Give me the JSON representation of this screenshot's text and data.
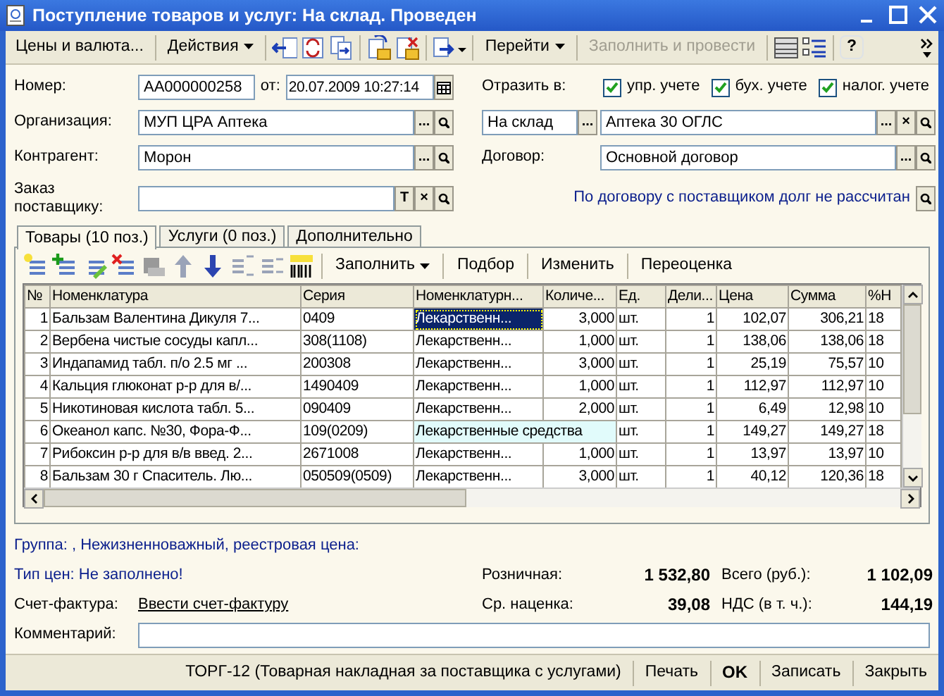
{
  "window": {
    "title": "Поступление товаров и услуг: На склад. Проведен"
  },
  "toolbar": {
    "buttons": [
      {
        "label": "Цены и валюта...",
        "kind": "button",
        "disabled": false
      },
      {
        "label": "Действия",
        "kind": "menu",
        "disabled": false
      },
      {
        "label": "Перейти",
        "kind": "menu",
        "disabled": false
      },
      {
        "label": "Заполнить и провести",
        "kind": "button",
        "disabled": true
      }
    ],
    "help": "?"
  },
  "number": {
    "label": "Номер:",
    "value": "АА000000258"
  },
  "date": {
    "label": "от:",
    "value": "20.07.2009 10:27:14"
  },
  "reflect": {
    "label": "Отразить в:",
    "options": [
      {
        "label": "упр. учете",
        "checked": true
      },
      {
        "label": "бух. учете",
        "checked": true
      },
      {
        "label": "налог. учете",
        "checked": true
      }
    ]
  },
  "organization": {
    "label": "Организация:",
    "value": "МУП ЦРА Аптека",
    "buttons": [
      "..."
    ],
    "search": true
  },
  "warehouse": {
    "kind_value": "На склад",
    "kind_buttons": [
      "..."
    ],
    "value": "Аптека 30 ОГЛС",
    "buttons": [
      "...",
      "×"
    ],
    "search": true
  },
  "counterparty": {
    "label": "Контрагент:",
    "value": "Морон",
    "buttons": [
      "..."
    ],
    "search": true
  },
  "contract": {
    "label": "Договор:",
    "value": "Основной договор",
    "buttons": [
      "..."
    ],
    "search": true
  },
  "order": {
    "label": "Заказ поставщику:",
    "buttons": [
      "T",
      "×"
    ],
    "search": true
  },
  "debt_link": {
    "text": "По договору с поставщиком долг не рассчитан",
    "search": true
  },
  "tabs": [
    {
      "label": "Товары (10 поз.)",
      "selected": true
    },
    {
      "label": "Услуги (0 поз.)",
      "selected": false
    },
    {
      "label": "Дополнительно",
      "selected": false
    }
  ],
  "tab_toolbar": {
    "buttons": [
      {
        "label": "Заполнить",
        "kind": "menu"
      },
      {
        "label": "Подбор",
        "kind": "button"
      },
      {
        "label": "Изменить",
        "kind": "button"
      },
      {
        "label": "Переоценка",
        "kind": "button"
      }
    ]
  },
  "table": {
    "columns": [
      "№",
      "Номенклатура",
      "Серия",
      "Номенклатурн...",
      "Количе...",
      "Ед.",
      "Дели...",
      "Цена",
      "Сумма",
      "%Н"
    ],
    "rows": [
      {
        "n": "1",
        "name": "Бальзам Валентина Дикуля 7...",
        "series": "0409",
        "type": "Лекарственн...",
        "qty": "3,000",
        "unit": "шт.",
        "div": "1",
        "price": "102,07",
        "sum": "306,21",
        "vat": "18",
        "selected": true,
        "expanded": false
      },
      {
        "n": "2",
        "name": "Вербена чистые сосуды капл...",
        "series": "308(1108)",
        "type": "Лекарственн...",
        "qty": "1,000",
        "unit": "шт.",
        "div": "1",
        "price": "138,06",
        "sum": "138,06",
        "vat": "18",
        "selected": false,
        "expanded": false
      },
      {
        "n": "3",
        "name": "Индапамид табл. п/о 2.5 мг ...",
        "series": "200308",
        "type": "Лекарственн...",
        "qty": "3,000",
        "unit": "шт.",
        "div": "1",
        "price": "25,19",
        "sum": "75,57",
        "vat": "10",
        "selected": false,
        "expanded": false
      },
      {
        "n": "4",
        "name": "Кальция глюконат р-р для в/...",
        "series": "1490409",
        "type": "Лекарственн...",
        "qty": "1,000",
        "unit": "шт.",
        "div": "1",
        "price": "112,97",
        "sum": "112,97",
        "vat": "10",
        "selected": false,
        "expanded": false
      },
      {
        "n": "5",
        "name": "Никотиновая кислота табл. 5...",
        "series": "090409",
        "type": "Лекарственн...",
        "qty": "2,000",
        "unit": "шт.",
        "div": "1",
        "price": "6,49",
        "sum": "12,98",
        "vat": "10",
        "selected": false,
        "expanded": false
      },
      {
        "n": "6",
        "name": "Океанол капс. №30, Фора-Ф...",
        "series": "109(0209)",
        "type": "Лекарственные средства",
        "unit": "шт.",
        "div": "1",
        "price": "149,27",
        "sum": "149,27",
        "vat": "18",
        "selected": false,
        "expanded": true
      },
      {
        "n": "7",
        "name": "Рибоксин р-р для в/в введ. 2...",
        "series": "2671008",
        "type": "Лекарственн...",
        "qty": "1,000",
        "unit": "шт.",
        "div": "1",
        "price": "13,97",
        "sum": "13,97",
        "vat": "10",
        "selected": false,
        "expanded": false
      },
      {
        "n": "8",
        "name": "Бальзам 30 г Спаситель. Лю...",
        "series": "050509(0509)",
        "type": "Лекарственн...",
        "qty": "3,000",
        "unit": "шт.",
        "div": "1",
        "price": "40,12",
        "sum": "120,36",
        "vat": "18",
        "selected": false,
        "expanded": false
      }
    ]
  },
  "group_text": "Группа: , Нежизненноважный, реестровая цена:",
  "price_type_text": "Тип цен: Не заполнено!",
  "invoice": {
    "label": "Счет-фактура:",
    "link": "Ввести счет-фактуру"
  },
  "totals": [
    {
      "label": "Розничная:",
      "value": "1 532,80"
    },
    {
      "label": "Всего (руб.):",
      "value": "1 102,09"
    },
    {
      "label": "Ср. наценка:",
      "value": "39,08"
    },
    {
      "label": "НДС (в т. ч.):",
      "value": "144,19"
    }
  ],
  "comment": {
    "label": "Комментарий:"
  },
  "status_bar": [
    {
      "label": "ТОРГ-12 (Товарная накладная за поставщика с услугами)",
      "kind": "button"
    },
    {
      "label": "Печать",
      "kind": "button"
    },
    {
      "label": "OK",
      "kind": "default"
    },
    {
      "label": "Записать",
      "kind": "button"
    },
    {
      "label": "Закрыть",
      "kind": "button"
    }
  ]
}
